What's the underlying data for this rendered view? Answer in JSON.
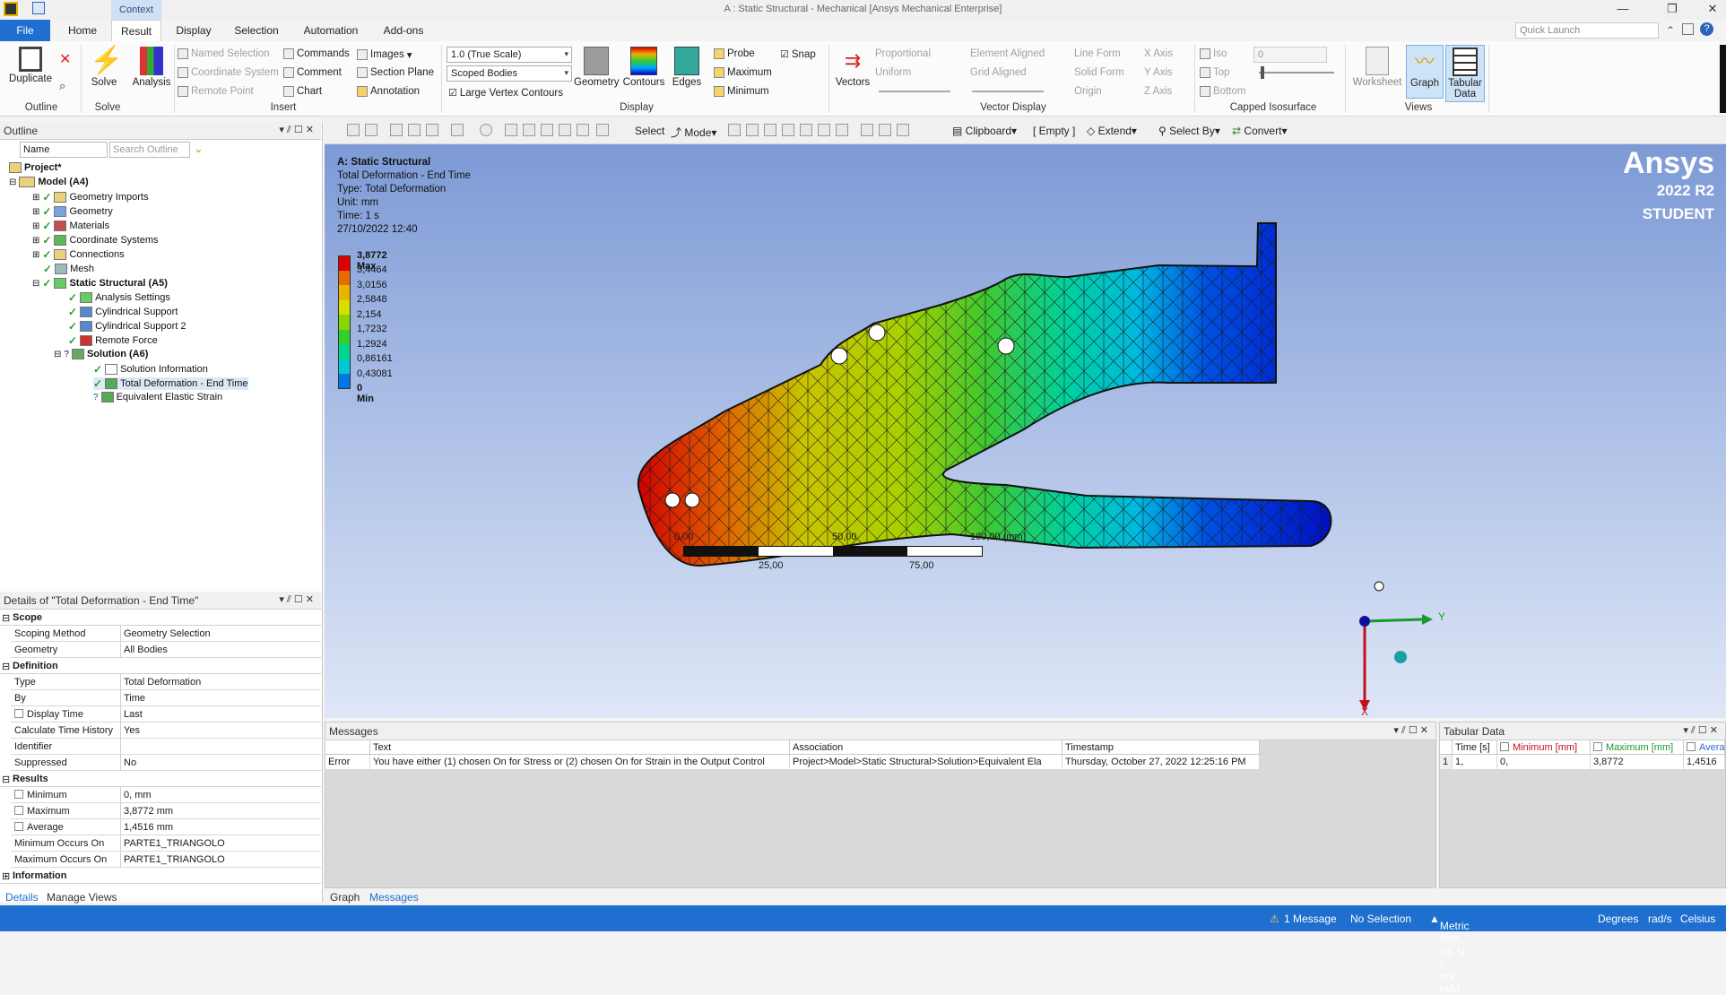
{
  "window": {
    "title": "A : Static Structural - Mechanical [Ansys Mechanical Enterprise]",
    "context_tab": "Context"
  },
  "tabs": [
    "File",
    "Home",
    "Result",
    "Display",
    "Selection",
    "Automation",
    "Add-ons"
  ],
  "quick_launch_placeholder": "Quick Launch",
  "ribbon": {
    "outline": {
      "duplicate": "Duplicate",
      "group": "Outline"
    },
    "solve": {
      "solve": "Solve",
      "analysis": "Analysis",
      "group": "Solve"
    },
    "insert": {
      "named_selection": "Named Selection",
      "coordinate_system": "Coordinate System",
      "remote_point": "Remote Point",
      "commands": "Commands",
      "comment": "Comment",
      "chart": "Chart",
      "images": "Images",
      "section_plane": "Section Plane",
      "annotation": "Annotation",
      "group": "Insert"
    },
    "display": {
      "scale": "1.0 (True Scale)",
      "bodies": "Scoped Bodies",
      "large_vertex": "Large Vertex Contours",
      "geometry": "Geometry",
      "contours": "Contours",
      "edges": "Edges",
      "probe": "Probe",
      "maximum": "Maximum",
      "minimum": "Minimum",
      "snap": "Snap",
      "group": "Display"
    },
    "vector": {
      "vectors": "Vectors",
      "proportional": "Proportional",
      "uniform": "Uniform",
      "element_aligned": "Element Aligned",
      "grid_aligned": "Grid Aligned",
      "line_form": "Line Form",
      "solid_form": "Solid Form",
      "origin": "Origin",
      "x_axis": "X Axis",
      "y_axis": "Y Axis",
      "z_axis": "Z Axis",
      "group": "Vector Display"
    },
    "capped": {
      "iso": "Iso",
      "top": "Top",
      "bottom": "Bottom",
      "value": "0",
      "group": "Capped Isosurface"
    },
    "views": {
      "worksheet": "Worksheet",
      "graph": "Graph",
      "tabular_data": "Tabular Data",
      "tabular_line1": "Tabular",
      "tabular_line2": "Data",
      "group": "Views"
    }
  },
  "toolbar": {
    "select": "Select",
    "mode": "Mode",
    "clipboard": "Clipboard",
    "empty": "[ Empty ]",
    "extend": "Extend",
    "select_by": "Select By",
    "convert": "Convert"
  },
  "outline": {
    "title": "Outline",
    "name_filter": "Name",
    "search_placeholder": "Search Outline",
    "tree": [
      {
        "label": "Project*",
        "bold": true
      },
      {
        "label": "Model (A4)",
        "bold": true
      },
      {
        "label": "Geometry Imports"
      },
      {
        "label": "Geometry"
      },
      {
        "label": "Materials"
      },
      {
        "label": "Coordinate Systems"
      },
      {
        "label": "Connections"
      },
      {
        "label": "Mesh"
      },
      {
        "label": "Static Structural (A5)",
        "bold": true
      },
      {
        "label": "Analysis Settings"
      },
      {
        "label": "Cylindrical Support"
      },
      {
        "label": "Cylindrical Support 2"
      },
      {
        "label": "Remote Force"
      },
      {
        "label": "Solution (A6)",
        "bold": true
      },
      {
        "label": "Solution Information"
      },
      {
        "label": "Total Deformation - End Time"
      },
      {
        "label": "Equivalent Elastic Strain"
      }
    ]
  },
  "details": {
    "title": "Details of \"Total Deformation - End Time\"",
    "sections": {
      "scope": "Scope",
      "definition": "Definition",
      "results": "Results",
      "information": "Information"
    },
    "rows": [
      {
        "k": "Scoping Method",
        "v": "Geometry Selection"
      },
      {
        "k": "Geometry",
        "v": "All Bodies"
      },
      {
        "k": "Type",
        "v": "Total Deformation"
      },
      {
        "k": "By",
        "v": "Time"
      },
      {
        "k": "Display Time",
        "v": "Last"
      },
      {
        "k": "Calculate Time History",
        "v": "Yes"
      },
      {
        "k": "Identifier",
        "v": ""
      },
      {
        "k": "Suppressed",
        "v": "No"
      },
      {
        "k": "Minimum",
        "v": "0, mm"
      },
      {
        "k": "Maximum",
        "v": "3,8772 mm"
      },
      {
        "k": "Average",
        "v": "1,4516 mm"
      },
      {
        "k": "Minimum Occurs On",
        "v": "PARTE1_TRIANGOLO"
      },
      {
        "k": "Maximum Occurs On",
        "v": "PARTE1_TRIANGOLO"
      }
    ]
  },
  "viewport": {
    "analysis": "A: Static Structural",
    "result": "Total Deformation - End Time",
    "type": "Type: Total Deformation",
    "unit": "Unit: mm",
    "time": "Time: 1 s",
    "date": "27/10/2022 12:40",
    "brand": "Ansys",
    "version": "2022 R2",
    "edition": "STUDENT",
    "legend": [
      {
        "label": "3,8772 Max",
        "color": "#e00000"
      },
      {
        "label": "3,4464",
        "color": "#e86a00"
      },
      {
        "label": "3,0156",
        "color": "#e8b400"
      },
      {
        "label": "2,5848",
        "color": "#d6e000"
      },
      {
        "label": "2,154",
        "color": "#8ad600"
      },
      {
        "label": "1,7232",
        "color": "#30d030"
      },
      {
        "label": "1,2924",
        "color": "#00d890"
      },
      {
        "label": "0,86161",
        "color": "#00c8d8"
      },
      {
        "label": "0,43081",
        "color": "#0078e8"
      },
      {
        "label": "0 Min",
        "color": "#0010d0"
      }
    ],
    "scale": {
      "t0": "0,00",
      "t50": "50,00",
      "t100": "100,00 (mm)",
      "t25": "25,00",
      "t75": "75,00"
    },
    "axis": {
      "x": "X",
      "y": "Y"
    }
  },
  "messages": {
    "title": "Messages",
    "headers": [
      "Text",
      "Association",
      "Timestamp"
    ],
    "row": {
      "type": "Error",
      "text": "You have either (1) chosen On for Stress or (2) chosen On for Strain in the Output Control",
      "association": "Project>Model>Static Structural>Solution>Equivalent Ela",
      "timestamp": "Thursday, October 27, 2022 12:25:16 PM"
    }
  },
  "tabular": {
    "title": "Tabular Data",
    "headers": [
      "Time [s]",
      "Minimum [mm]",
      "Maximum [mm]",
      "Avera"
    ],
    "row": {
      "idx": "1",
      "time": "1,",
      "min": "0,",
      "max": "3,8772",
      "avg": "1,4516"
    }
  },
  "bottom_tabs": {
    "details": "Details",
    "manage_views": "Manage Views",
    "graph": "Graph",
    "messages": "Messages"
  },
  "status": {
    "message": "1 Message",
    "selection": "No Selection",
    "units": "Metric (mm, kg, N, s, mV, mA)",
    "degrees": "Degrees",
    "rads": "rad/s",
    "temp": "Celsius"
  }
}
